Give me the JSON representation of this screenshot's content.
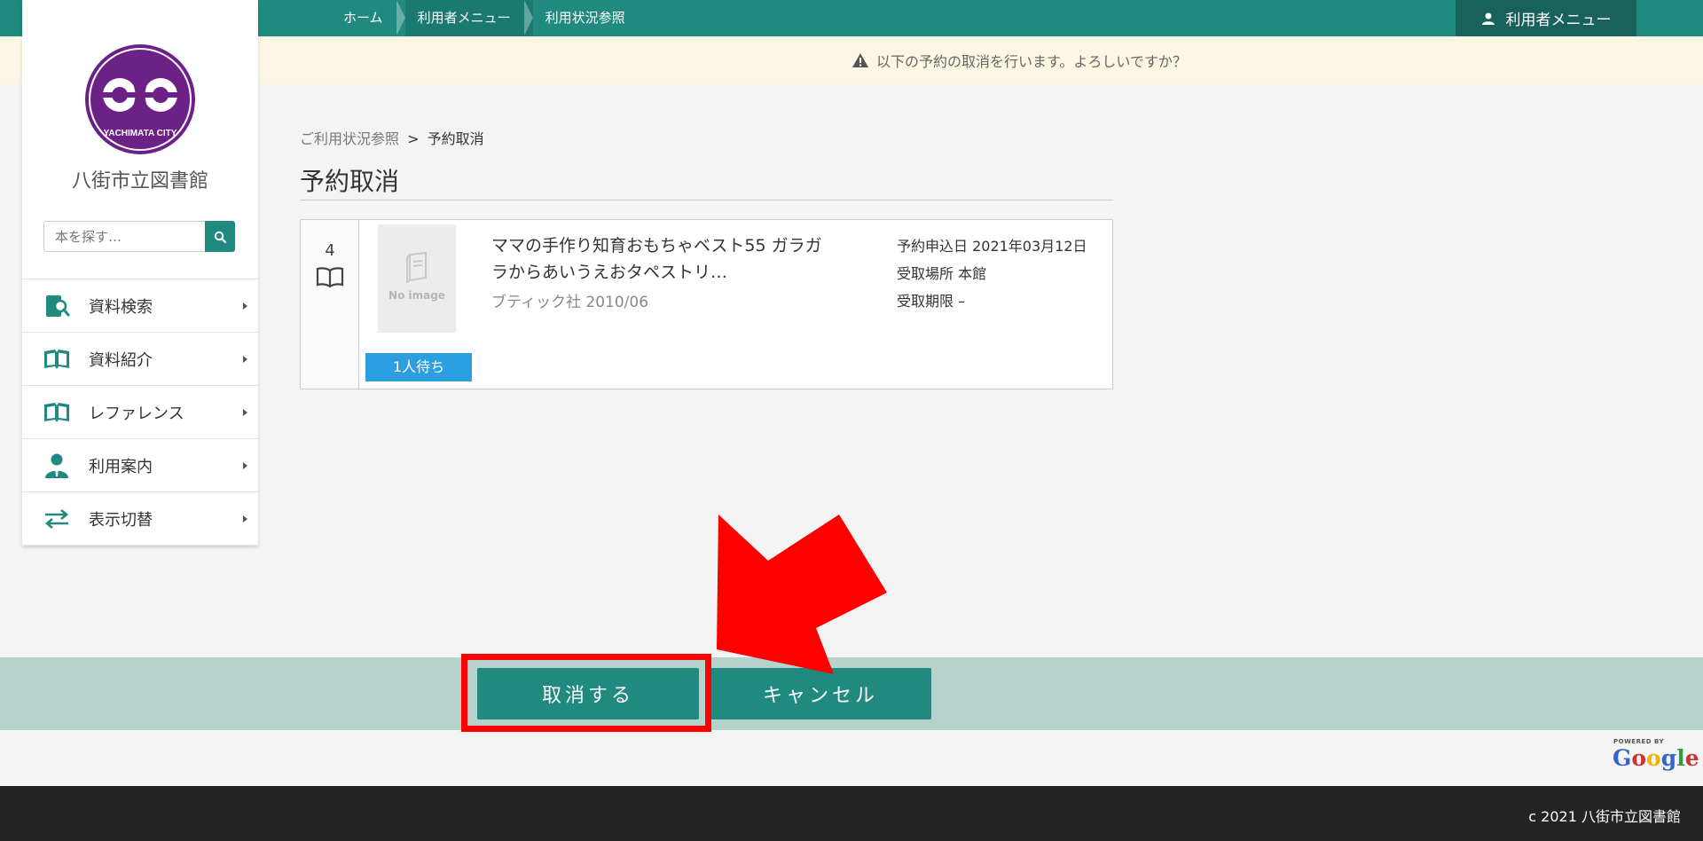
{
  "topbar": {
    "crumbs": [
      "ホーム",
      "利用者メニュー",
      "利用状況参照"
    ],
    "user_menu": "利用者メニュー"
  },
  "notice": {
    "text": "以下の予約の取消を行います。よろしいですか？"
  },
  "sidebar": {
    "logo_text": "YACHIMATA CITY",
    "library_name": "八街市立図書館",
    "search_placeholder": "本を探す…",
    "menu": [
      {
        "label": "資料検索",
        "icon": "search-book-icon"
      },
      {
        "label": "資料紹介",
        "icon": "open-book-icon"
      },
      {
        "label": "レファレンス",
        "icon": "open-book-icon"
      },
      {
        "label": "利用案内",
        "icon": "person-icon"
      },
      {
        "label": "表示切替",
        "icon": "swap-arrows-icon"
      }
    ]
  },
  "main": {
    "breadcrumb_parent": "ご利用状況参照",
    "breadcrumb_sep": ">",
    "breadcrumb_current": "予約取消",
    "title": "予約取消",
    "item": {
      "number": "4",
      "no_image": "No image",
      "waiting": "1人待ち",
      "title": "ママの手作り知育おもちゃベスト55 ガラガラからあいうえおタペストリ…",
      "publisher": "ブティック社 2010/06",
      "reserve_date": "予約申込日 2021年03月12日",
      "pickup_place": "受取場所 本館",
      "pickup_limit": "受取期限 –"
    }
  },
  "actions": {
    "confirm_label": "取消する",
    "cancel_label": "キャンセル"
  },
  "powered": {
    "small": "POWERED BY",
    "brand": "Google"
  },
  "footer": {
    "copyright": "c 2021 八街市立図書館"
  },
  "colors": {
    "primary": "#208a80",
    "highlight": "#ff0000",
    "waiting_badge": "#2c9fe0"
  }
}
